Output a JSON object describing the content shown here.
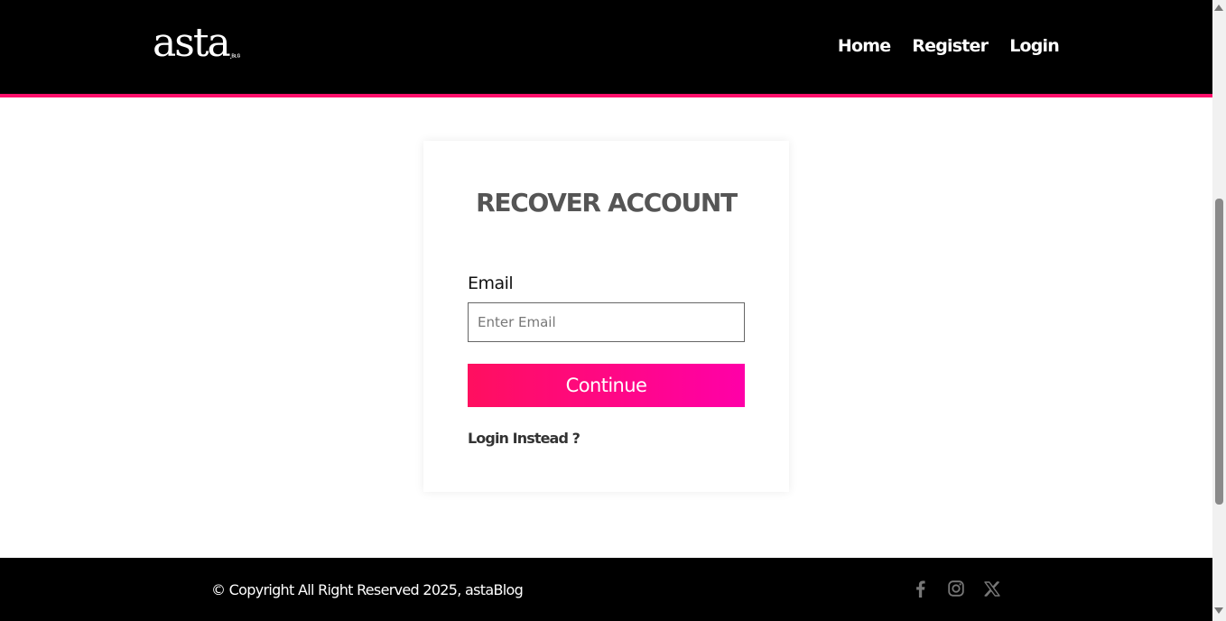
{
  "header": {
    "logo_text": "asta",
    "logo_suffix": ".ᴮᴸᴳ",
    "nav": [
      {
        "label": "Home"
      },
      {
        "label": "Register"
      },
      {
        "label": "Login"
      }
    ]
  },
  "form": {
    "title": "RECOVER ACCOUNT",
    "email_label": "Email",
    "email_placeholder": "Enter Email",
    "email_value": "",
    "continue_label": "Continue",
    "login_instead_label": "Login Instead ?"
  },
  "footer": {
    "copyright": "© Copyright All Right Reserved 2025, astaBlog",
    "socials": [
      {
        "icon": "facebook-icon"
      },
      {
        "icon": "instagram-icon"
      },
      {
        "icon": "x-twitter-icon"
      }
    ]
  },
  "colors": {
    "accent": "#ff0f6b",
    "button_gradient_start": "#ff0f5f",
    "button_gradient_end": "#ff00a8",
    "header_bg": "#000000",
    "footer_bg": "#000000"
  }
}
